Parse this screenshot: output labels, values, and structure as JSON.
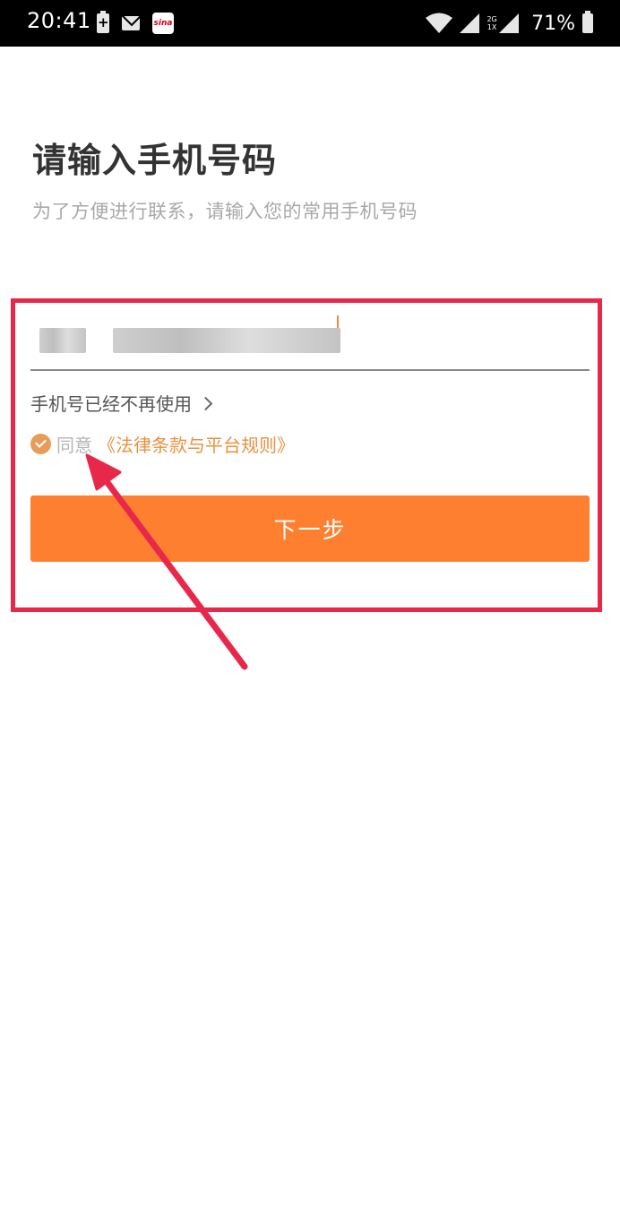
{
  "status_bar": {
    "time": "20:41",
    "sina_label": "sina",
    "network_top": "2G",
    "network_bottom": "1X",
    "battery_percent": "71%"
  },
  "page": {
    "title": "请输入手机号码",
    "subtitle": "为了方便进行联系，请输入您的常用手机号码"
  },
  "phone_input": {
    "value_obscured": true
  },
  "unused_link": {
    "label": "手机号已经不再使用"
  },
  "agreement": {
    "checked": true,
    "prefix": "同意",
    "link": "《法律条款与平台规则》"
  },
  "next_button": {
    "label": "下一步"
  },
  "colors": {
    "accent": "#ff7f31",
    "link": "#e9913f",
    "annotation": "#e8284a",
    "title": "#333333",
    "subtitle": "#a8a8a8"
  },
  "icons": {
    "chevron": "chevron-right-icon",
    "check": "checkmark-circle-icon"
  }
}
